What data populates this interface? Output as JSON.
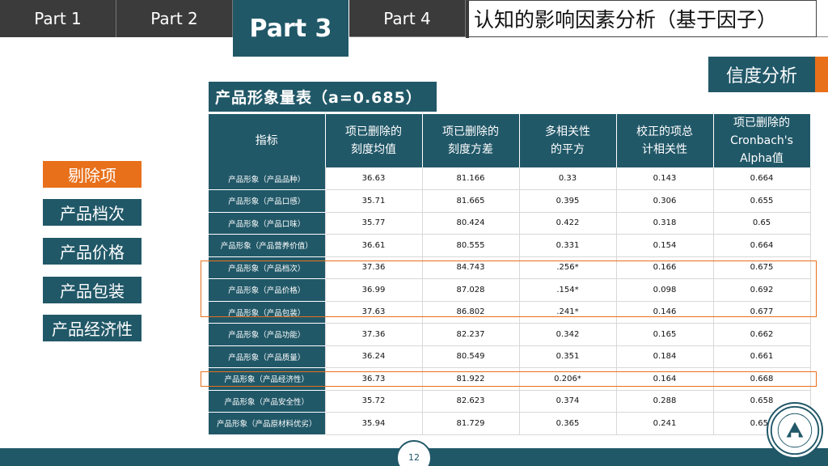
{
  "tabs": [
    {
      "label": "Part 1"
    },
    {
      "label": "Part 2"
    },
    {
      "label": "Part 3"
    },
    {
      "label": "Part 4"
    }
  ],
  "title": "认知的影响因素分析（基于因子）",
  "badge": "信度分析",
  "left_buttons": [
    "剔除项",
    "产品档次",
    "产品价格",
    "产品包装",
    "产品经济性"
  ],
  "scale_title": "产品形象量表（a=0.685）",
  "table": {
    "headers": [
      "指标",
      "项已删除的\n刻度均值",
      "项已删除的\n刻度方差",
      "多相关性\n的平方",
      "校正的项总\n计相关性",
      "项已删除的\nCronbach's\nAlpha值"
    ],
    "rows": [
      [
        "产品形象（产品品种）",
        "36.63",
        "81.166",
        "0.33",
        "0.143",
        "0.664"
      ],
      [
        "产品形象（产品口感）",
        "35.71",
        "81.665",
        "0.395",
        "0.306",
        "0.655"
      ],
      [
        "产品形象（产品口味）",
        "35.77",
        "80.424",
        "0.422",
        "0.318",
        "0.65"
      ],
      [
        "产品形象（产品营养价值）",
        "36.61",
        "80.555",
        "0.331",
        "0.154",
        "0.664"
      ],
      [
        "产品形象（产品档次）",
        "37.36",
        "84.743",
        ".256*",
        "0.166",
        "0.675"
      ],
      [
        "产品形象（产品价格）",
        "36.99",
        "87.028",
        ".154*",
        "0.098",
        "0.692"
      ],
      [
        "产品形象（产品包装）",
        "37.63",
        "86.802",
        ".241*",
        "0.146",
        "0.677"
      ],
      [
        "产品形象（产品功能）",
        "37.36",
        "82.237",
        "0.342",
        "0.165",
        "0.662"
      ],
      [
        "产品形象（产品质量）",
        "36.24",
        "80.549",
        "0.351",
        "0.184",
        "0.661"
      ],
      [
        "产品形象（产品经济性）",
        "36.73",
        "81.922",
        "0.206*",
        "0.164",
        "0.668"
      ],
      [
        "产品形象（产品安全性）",
        "35.72",
        "82.623",
        "0.374",
        "0.288",
        "0.658"
      ],
      [
        "产品形象（产品原材料优劣）",
        "35.94",
        "81.729",
        "0.365",
        "0.241",
        "0.659"
      ]
    ]
  },
  "page_number": "12"
}
